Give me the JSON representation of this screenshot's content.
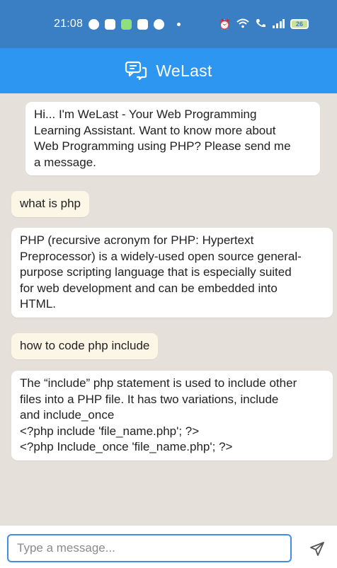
{
  "status_bar": {
    "time": "21:08",
    "battery": "26"
  },
  "header": {
    "title": "WeLast"
  },
  "messages": [
    {
      "role": "bot",
      "text": "Hi... I'm WeLast - Your Web Programming\nLearning Assistant. Want to know more about\nWeb Programming using PHP? Please send me\na message."
    },
    {
      "role": "user",
      "text": "what is php"
    },
    {
      "role": "bot",
      "text": "PHP (recursive acronym for PHP: Hypertext\nPreprocessor) is a widely-used open source general-\npurpose scripting language that is especially suited\nfor web development and can be embedded into\nHTML."
    },
    {
      "role": "user",
      "text": "how to code php include"
    },
    {
      "role": "bot",
      "text": "The “include” php statement is used to include other\nfiles into a PHP file. It has two variations, include\nand include_once\n<?php include 'file_name.php'; ?>\n<?php Include_once 'file_name.php'; ?>"
    }
  ],
  "composer": {
    "placeholder": "Type a message...",
    "value": ""
  },
  "icons": {
    "app_logo": "chat-bubbles-icon",
    "send": "send-icon"
  },
  "colors": {
    "status_bar": "#3a7ec4",
    "header": "#2d96f0",
    "chat_background": "#e6e0da",
    "user_bubble": "#fbf6e6",
    "bot_bubble": "#ffffff"
  }
}
